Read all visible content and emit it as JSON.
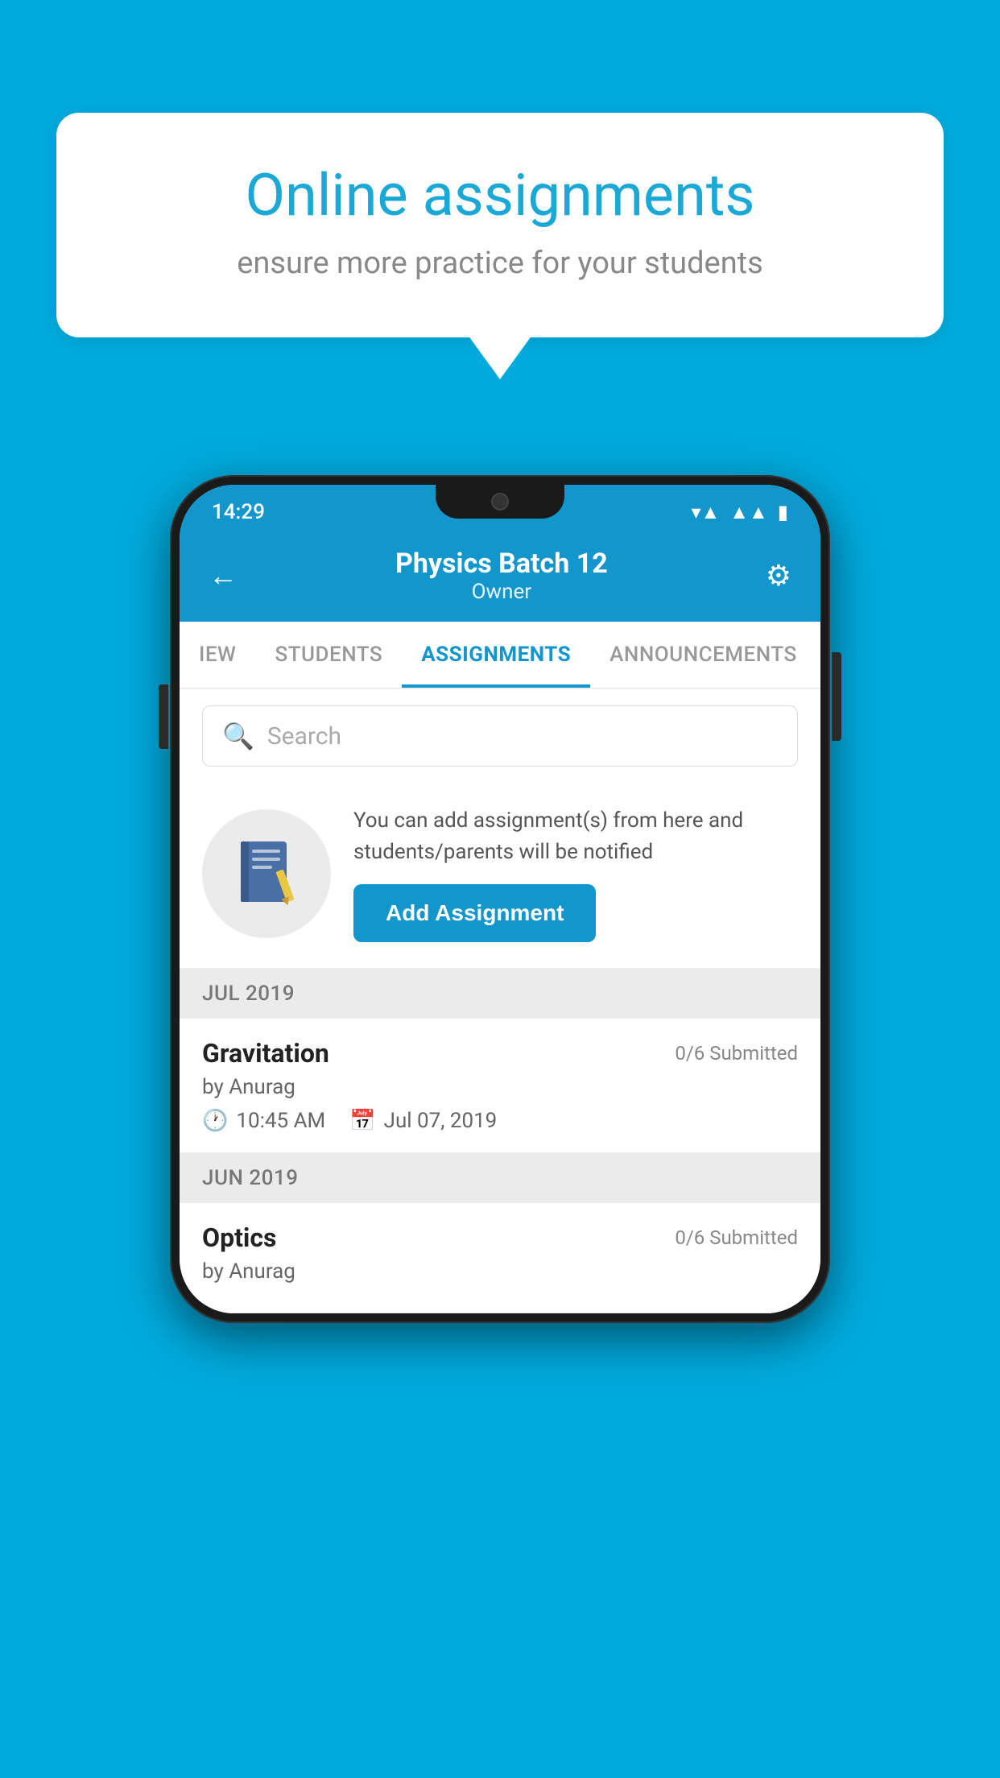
{
  "background_color": "#00AADD",
  "speech_bubble": {
    "title": "Online assignments",
    "subtitle": "ensure more practice for your students"
  },
  "phone": {
    "status_bar": {
      "time": "14:29"
    },
    "header": {
      "title": "Physics Batch 12",
      "subtitle": "Owner",
      "back_label": "←",
      "gear_label": "⚙"
    },
    "tabs": [
      {
        "label": "IEW",
        "active": false
      },
      {
        "label": "STUDENTS",
        "active": false
      },
      {
        "label": "ASSIGNMENTS",
        "active": true
      },
      {
        "label": "ANNOUNCEMENTS",
        "active": false
      }
    ],
    "search": {
      "placeholder": "Search"
    },
    "promo": {
      "text": "You can add assignment(s) from here and students/parents will be notified",
      "button_label": "Add Assignment"
    },
    "sections": [
      {
        "header": "JUL 2019",
        "assignments": [
          {
            "title": "Gravitation",
            "submitted": "0/6 Submitted",
            "author": "by Anurag",
            "time": "10:45 AM",
            "date": "Jul 07, 2019"
          }
        ]
      },
      {
        "header": "JUN 2019",
        "assignments": [
          {
            "title": "Optics",
            "submitted": "0/6 Submitted",
            "author": "by Anurag",
            "time": "",
            "date": ""
          }
        ]
      }
    ]
  }
}
